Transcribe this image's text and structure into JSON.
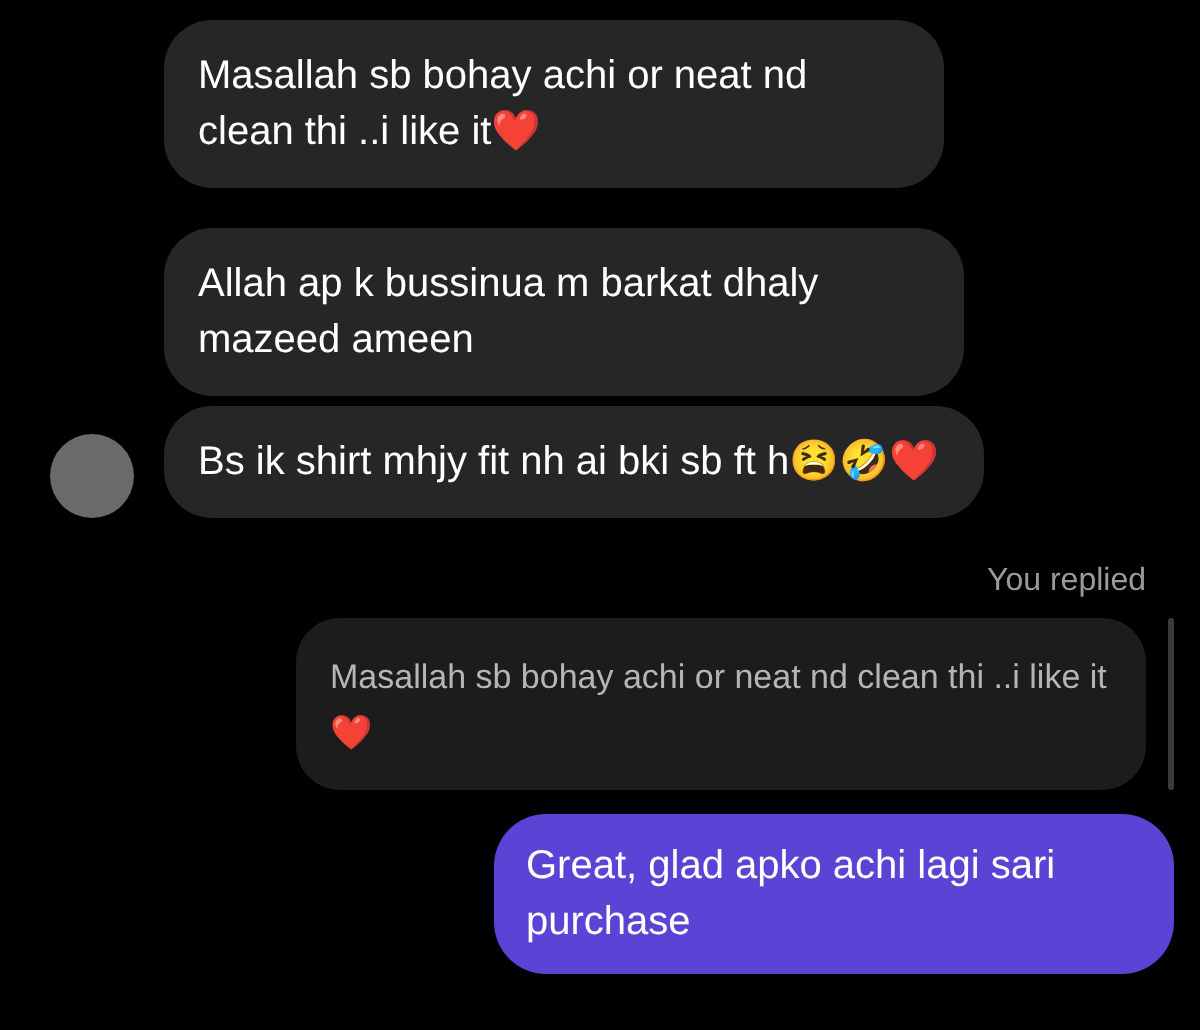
{
  "messages": [
    {
      "text": "Masallah sb bohay achi or neat nd clean thi ..i like it❤️"
    },
    {
      "text": "Allah ap k bussinua m barkat dhaly mazeed ameen"
    },
    {
      "text": "Bs ik shirt mhjy fit nh ai bki sb ft h😫🤣❤️"
    }
  ],
  "reply": {
    "label": "You replied",
    "quoted": "Masallah sb bohay achi or neat nd clean thi ..i like it❤️",
    "text": "Great, glad apko achi lagi sari purchase"
  }
}
